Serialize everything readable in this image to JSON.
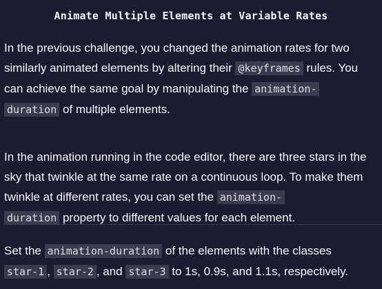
{
  "challenge": {
    "title": "Animate Multiple Elements at Variable Rates"
  },
  "paragraph1": {
    "t1": "In the previous challenge, you changed the animation rates for two similarly animated elements by altering their ",
    "c1": "@keyframes",
    "t2": " rules. You can achieve the same goal by manipulating the ",
    "c2a": "animation-",
    "c2b": "duration",
    "t3": " of multiple elements."
  },
  "paragraph2": {
    "t1": "In the animation running in the code editor, there are three stars in the sky that twinkle at the same rate on a continuous loop. To make them twinkle at different rates, you can set the ",
    "c1a": "animation-",
    "c1b": "duration",
    "t2": " property to different values for each element."
  },
  "instructions": {
    "t1": "Set the ",
    "c1": "animation-duration",
    "t2": " of the elements with the classes ",
    "c2": "star-1",
    "t3": ", ",
    "c3": "star-2",
    "t4": ", and ",
    "c4": "star-3",
    "t5": " to 1s, 0.9s, and 1.1s, respectively."
  }
}
